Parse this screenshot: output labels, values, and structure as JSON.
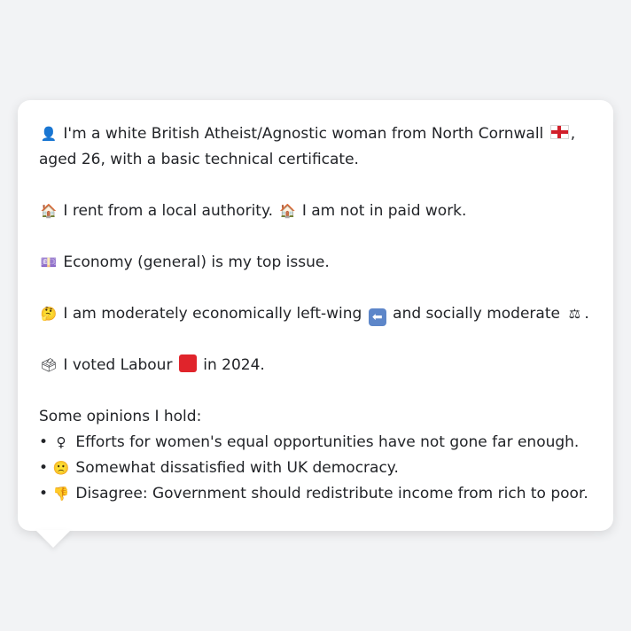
{
  "profile": {
    "line1": {
      "icon": "person-silhouette-icon",
      "icon_glyph": "👤",
      "text_a": "I'm a white British Atheist/Agnostic woman from North Cornwall",
      "flag_icon": "england-flag-icon",
      "text_b": ", aged 26, with a basic technical certificate."
    },
    "line2": {
      "icon_glyph": "🏠",
      "text_a": "I rent from a local authority.",
      "icon2_glyph": "🏠",
      "text_b": "I am not in paid work."
    },
    "line3": {
      "icon_glyph": "💷",
      "text": "Economy (general) is my top issue."
    },
    "line4": {
      "icon_glyph": "🤔",
      "text_a": "I am moderately economically left-wing",
      "arrow_glyph": "⬅",
      "text_b": "and socially moderate",
      "scales_glyph": "⚖",
      "text_c": "."
    },
    "line5": {
      "icon_glyph": "🗳",
      "text_a": "I voted Labour",
      "party_color": "#e0242b",
      "text_b": "in 2024."
    }
  },
  "opinions": {
    "heading": "Some opinions I hold:",
    "bullet": "•",
    "items": [
      {
        "icon_glyph": "♀",
        "text": "Efforts for women's equal opportunities have not gone far enough."
      },
      {
        "icon_glyph": "🙁",
        "text": "Somewhat dissatisfied with UK democracy."
      },
      {
        "icon_glyph": "👎",
        "text": "Disagree: Government should redistribute income from rich to poor."
      }
    ]
  },
  "colors": {
    "background": "#f2f3f5",
    "bubble": "#ffffff",
    "text": "#222428"
  }
}
